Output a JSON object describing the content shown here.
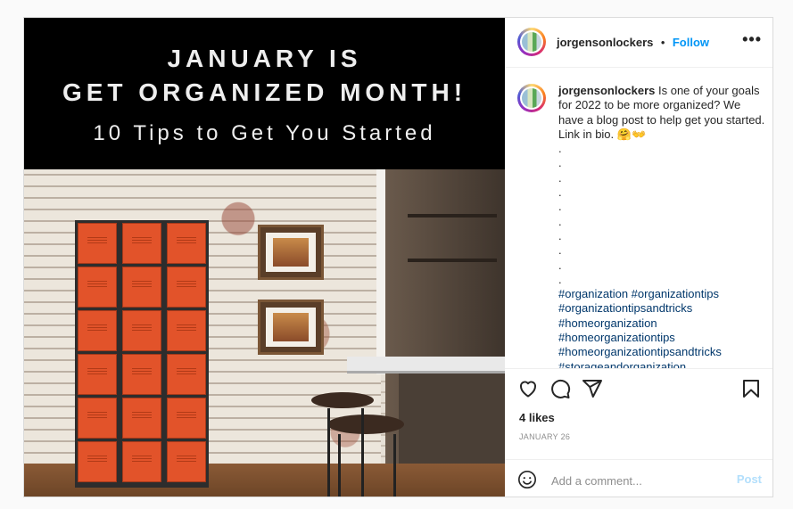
{
  "banner": {
    "line1": "JANUARY IS",
    "line2": "GET ORGANIZED MONTH!",
    "line3": "10 Tips to Get You Started"
  },
  "header": {
    "username": "jorgensonlockers",
    "separator": "•",
    "follow_label": "Follow",
    "more_label": "•••"
  },
  "caption": {
    "username": "jorgensonlockers",
    "text": "Is one of your goals for 2022 to be more organized? We have a blog post to help get you started. Link in bio. 🤗👐",
    "dots": [
      ".",
      ".",
      ".",
      ".",
      ".",
      ".",
      ".",
      ".",
      ".",
      "."
    ],
    "hashtags": [
      "#organization #organizationtips",
      "#organizationtipsandtricks",
      "#homeorganization",
      "#homeorganizationtips",
      "#homeorganizationtipsandtricks",
      "#storageandorganization #organizingtips"
    ]
  },
  "actions": {
    "icons": [
      "heart-icon",
      "comment-icon",
      "share-icon",
      "bookmark-icon"
    ],
    "likes": "4 likes",
    "date": "JANUARY 26"
  },
  "comment_box": {
    "placeholder": "Add a comment...",
    "post_label": "Post",
    "emoji_icon": "smiley-icon"
  },
  "colors": {
    "follow": "#0095f6",
    "hashtag": "#00376b",
    "post_disabled": "#b2dffc",
    "locker_orange": "#e2532a"
  }
}
